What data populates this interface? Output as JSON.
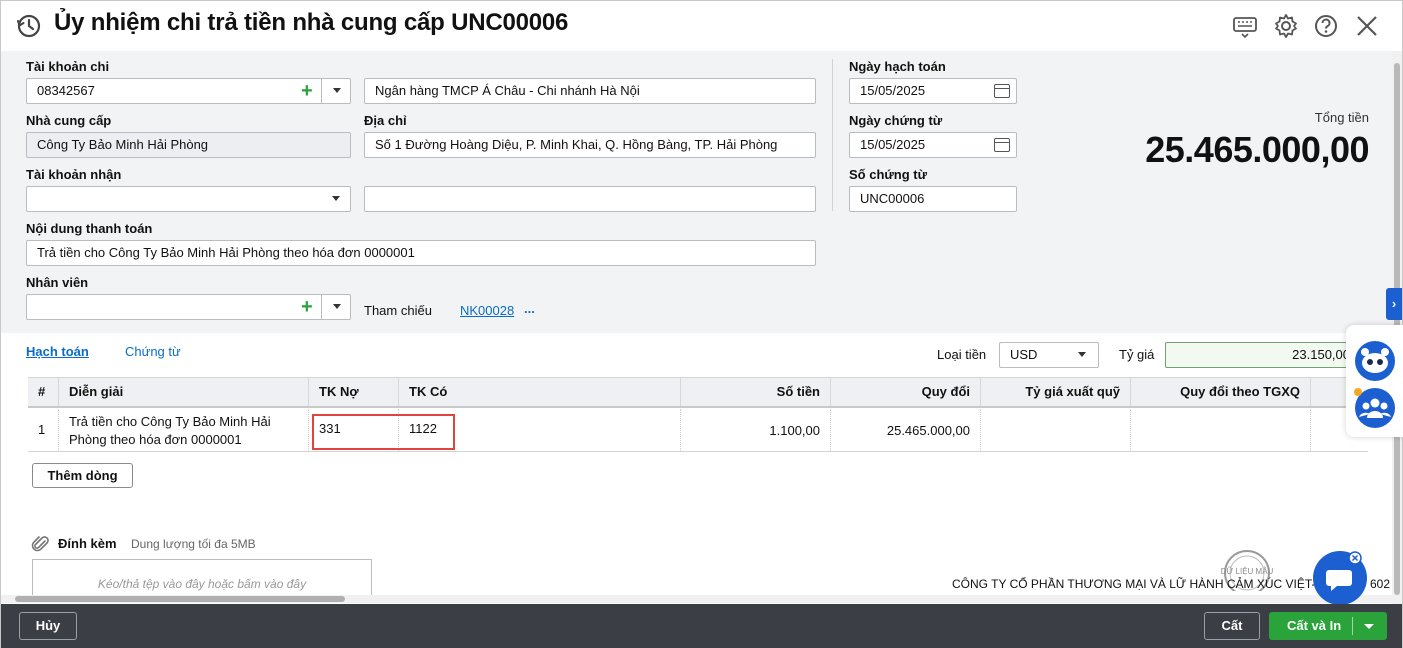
{
  "header": {
    "title": "Ủy nhiệm chi trả tiền nhà cung cấp UNC00006"
  },
  "form": {
    "tai_khoan_chi": {
      "label": "Tài khoản chi",
      "value": "08342567",
      "bank": "Ngân hàng TMCP Á Châu - Chi nhánh Hà Nội"
    },
    "nha_cung_cap": {
      "label": "Nhà cung cấp",
      "value": "Công Ty Bảo Minh Hải Phòng"
    },
    "dia_chi": {
      "label": "Địa chỉ",
      "value": "Số 1 Đường Hoàng Diệu, P. Minh Khai, Q. Hồng Bàng, TP. Hải Phòng"
    },
    "tai_khoan_nhan": {
      "label": "Tài khoản nhận",
      "value": "",
      "extra": ""
    },
    "noi_dung": {
      "label": "Nội dung thanh toán",
      "value": "Trả tiền cho Công Ty Bảo Minh Hải Phòng theo hóa đơn 0000001"
    },
    "nhan_vien": {
      "label": "Nhân viên",
      "value": ""
    },
    "tham_chieu": {
      "label": "Tham chiếu",
      "link": "NK00028",
      "more": "..."
    },
    "ngay_hach_toan": {
      "label": "Ngày hạch toán",
      "value": "15/05/2025"
    },
    "ngay_chung_tu": {
      "label": "Ngày chứng từ",
      "value": "15/05/2025"
    },
    "so_chung_tu": {
      "label": "Số chứng từ",
      "value": "UNC00006"
    },
    "tong_tien": {
      "label": "Tổng tiền",
      "value": "25.465.000,00"
    }
  },
  "tabs": [
    {
      "label": "Hạch toán",
      "active": true
    },
    {
      "label": "Chứng từ",
      "active": false
    }
  ],
  "currency": {
    "label": "Loại tiền",
    "value": "USD",
    "rate_label": "Tỷ giá",
    "rate": "23.150,00"
  },
  "grid": {
    "columns": [
      "#",
      "Diễn giải",
      "TK Nợ",
      "TK Có",
      "Số tiền",
      "Quy đổi",
      "Tỷ giá xuất quỹ",
      "Quy đổi theo TGXQ"
    ],
    "rows": [
      {
        "no": "1",
        "desc_line1": "Trả tiền cho Công Ty Bảo Minh Hải",
        "desc_line2": "Phòng theo hóa đơn 0000001",
        "debit": "331",
        "credit": "1122",
        "amount": "1.100,00",
        "converted": "25.465.000,00",
        "rate_out": "",
        "converted_out": ""
      }
    ]
  },
  "add_row_label": "Thêm dòng",
  "attach": {
    "label": "Đính kèm",
    "hint": "Dung lượng tối đa 5MB",
    "drop": "Kéo/thả tệp vào đây hoặc bấm vào đây"
  },
  "company": "CÔNG TY CỔ PHẦN THƯƠNG MẠI VÀ LỮ HÀNH CẢM XÚC VIỆT-QU",
  "company_suffix": "602",
  "stamp": "DỮ LIỆU MẪU",
  "footer": {
    "cancel": "Hủy",
    "save": "Cất",
    "save_print": "Cất và In"
  },
  "colors": {
    "accent": "#0a6cc4",
    "green": "#2aa33a",
    "highlight": "#e0443e",
    "footer": "#3b3f45"
  }
}
